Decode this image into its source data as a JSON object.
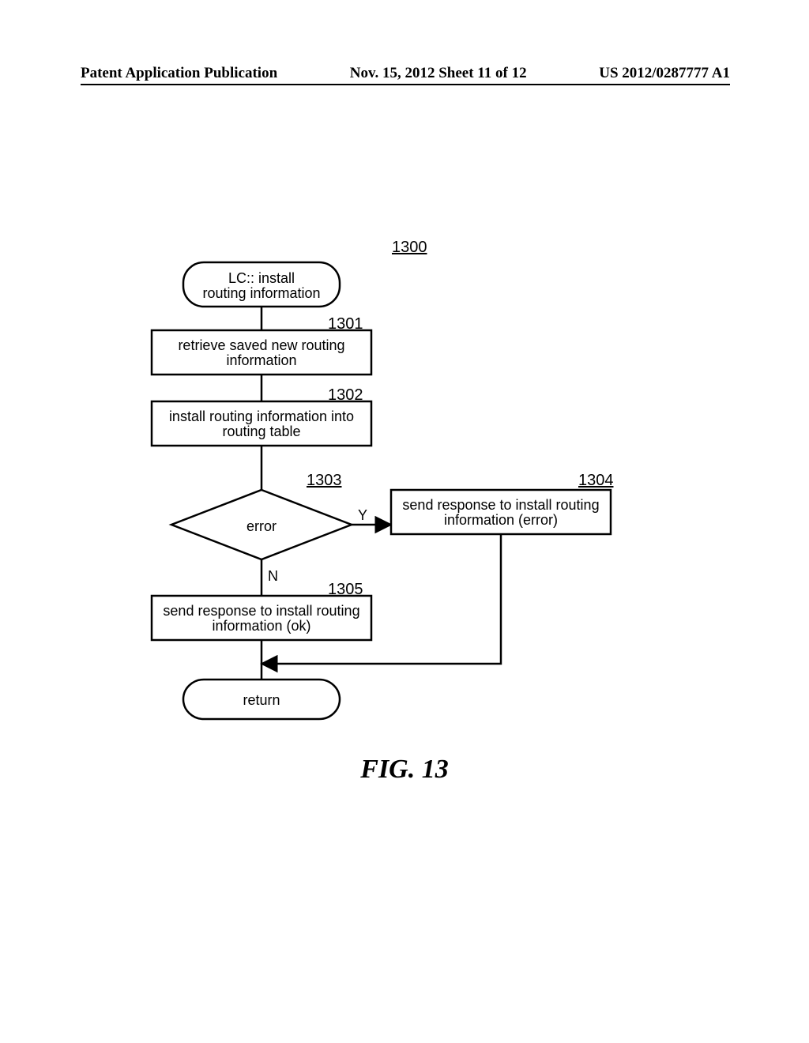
{
  "header": {
    "left": "Patent Application Publication",
    "center": "Nov. 15, 2012 Sheet 11 of 12",
    "right": "US 2012/0287777 A1"
  },
  "figure_label": "FIG. 13",
  "chart_data": {
    "type": "flowchart",
    "figure_number": "1300",
    "nodes": [
      {
        "id": "start",
        "kind": "terminator",
        "text_lines": [
          "LC:: install",
          "routing information"
        ]
      },
      {
        "id": "1301",
        "kind": "process",
        "ref": "1301",
        "text_lines": [
          "retrieve saved new routing",
          "information"
        ]
      },
      {
        "id": "1302",
        "kind": "process",
        "ref": "1302",
        "text_lines": [
          "install routing information into",
          "routing table"
        ]
      },
      {
        "id": "1303",
        "kind": "decision",
        "ref": "1303",
        "text_lines": [
          "error"
        ]
      },
      {
        "id": "1304",
        "kind": "process",
        "ref": "1304",
        "text_lines": [
          "send response to install routing",
          "information (error)"
        ]
      },
      {
        "id": "1305",
        "kind": "process",
        "ref": "1305",
        "text_lines": [
          "send response to install routing",
          "information (ok)"
        ]
      },
      {
        "id": "return",
        "kind": "terminator",
        "text_lines": [
          "return"
        ]
      }
    ],
    "edges": [
      {
        "from": "start",
        "to": "1301"
      },
      {
        "from": "1301",
        "to": "1302"
      },
      {
        "from": "1302",
        "to": "1303"
      },
      {
        "from": "1303",
        "to": "1304",
        "label": "Y"
      },
      {
        "from": "1303",
        "to": "1305",
        "label": "N"
      },
      {
        "from": "1305",
        "to": "return"
      },
      {
        "from": "1304",
        "to": "return"
      }
    ]
  }
}
